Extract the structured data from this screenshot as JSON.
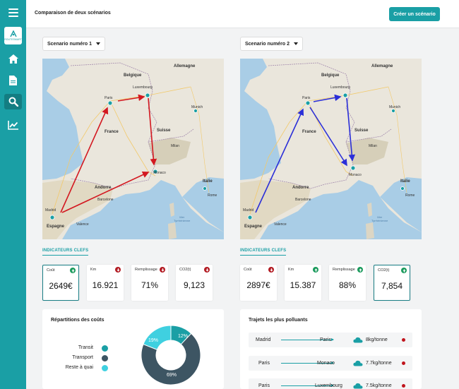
{
  "header": {
    "title": "Comparaison de deux scénarios",
    "create_button": "Créer un scénario"
  },
  "sidebar": {
    "logo_text": "ROUTESMART",
    "items": [
      "home-icon",
      "document-icon",
      "search-icon",
      "chart-icon"
    ]
  },
  "scenarios": [
    {
      "dropdown_label": "Scenario numéro 1"
    },
    {
      "dropdown_label": "Scenario numéro 2"
    }
  ],
  "map_labels": {
    "belgique": "Belgique",
    "allemagne": "Allemagne",
    "luxembourg": "Luxembourg",
    "paris": "Paris",
    "munich": "Munich",
    "france": "France",
    "suisse": "Suisse",
    "milan": "Milan",
    "monaco": "Monaco",
    "andorre": "Andorre",
    "italie": "Italie",
    "rome": "Rome",
    "barcelone": "Barcelone",
    "madrid": "Madrid",
    "espagne": "Espagne",
    "valence": "Valence",
    "mer_line1": "Mer",
    "mer_line2": "Tyrrhénienne"
  },
  "route_colors": {
    "scenario1": "#d31820",
    "scenario2": "#2b2fd8"
  },
  "kpis": {
    "header": "INDICATEURS CLEFS",
    "labels": [
      "Coût",
      "Km",
      "Remplissage",
      "CO2(t)"
    ],
    "scenario1": [
      "2649€",
      "16.921",
      "71%",
      "9,123"
    ],
    "scenario2": [
      "2897€",
      "15.387",
      "88%",
      "7,854"
    ]
  },
  "cost_split": {
    "title": "Répartitions des coûts",
    "legend": [
      "Transit",
      "Transport",
      "Reste à quai"
    ],
    "colors": {
      "transit": "#1a9fa5",
      "transport": "#3d5563",
      "reste": "#3fd0e0"
    },
    "values": {
      "transit": 12,
      "transport": 69,
      "reste": 19
    },
    "labels": {
      "transit": "12%",
      "transport": "69%",
      "reste": "19%"
    }
  },
  "polluting": {
    "title": "Trajets les plus polluants",
    "rows": [
      {
        "from": "Madrid",
        "to": "Paris",
        "co2": "8kg/tonne"
      },
      {
        "from": "Paris",
        "to": "Monaco",
        "co2": "7.7kg/tonne"
      },
      {
        "from": "Paris",
        "to": "Luxembourg",
        "co2": "7.5kg/tonne"
      }
    ]
  }
}
